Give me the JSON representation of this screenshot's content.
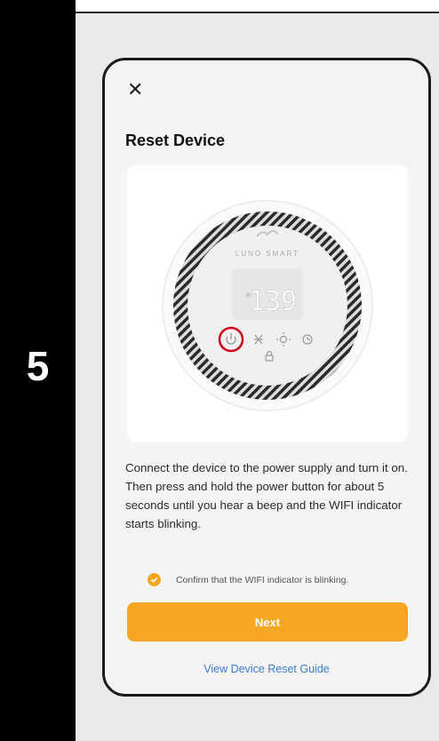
{
  "step": {
    "number": "5"
  },
  "dialog": {
    "close_icon": "close-icon",
    "title": "Reset Device",
    "instructions": "Connect the device to the power supply and turn it on. Then press and hold the power button for about 5 seconds until you hear a beep and the WIFI indicator starts blinking.",
    "confirm_label": "Confirm that the WIFI indicator is blinking.",
    "confirm_checked": true,
    "next_label": "Next",
    "guide_link": "View Device Reset Guide"
  },
  "device": {
    "brand": "LUNO SMART",
    "display_value": "139"
  },
  "colors": {
    "accent": "#f5a623",
    "link": "#3a7bd5",
    "highlight_ring": "#d0021b"
  }
}
